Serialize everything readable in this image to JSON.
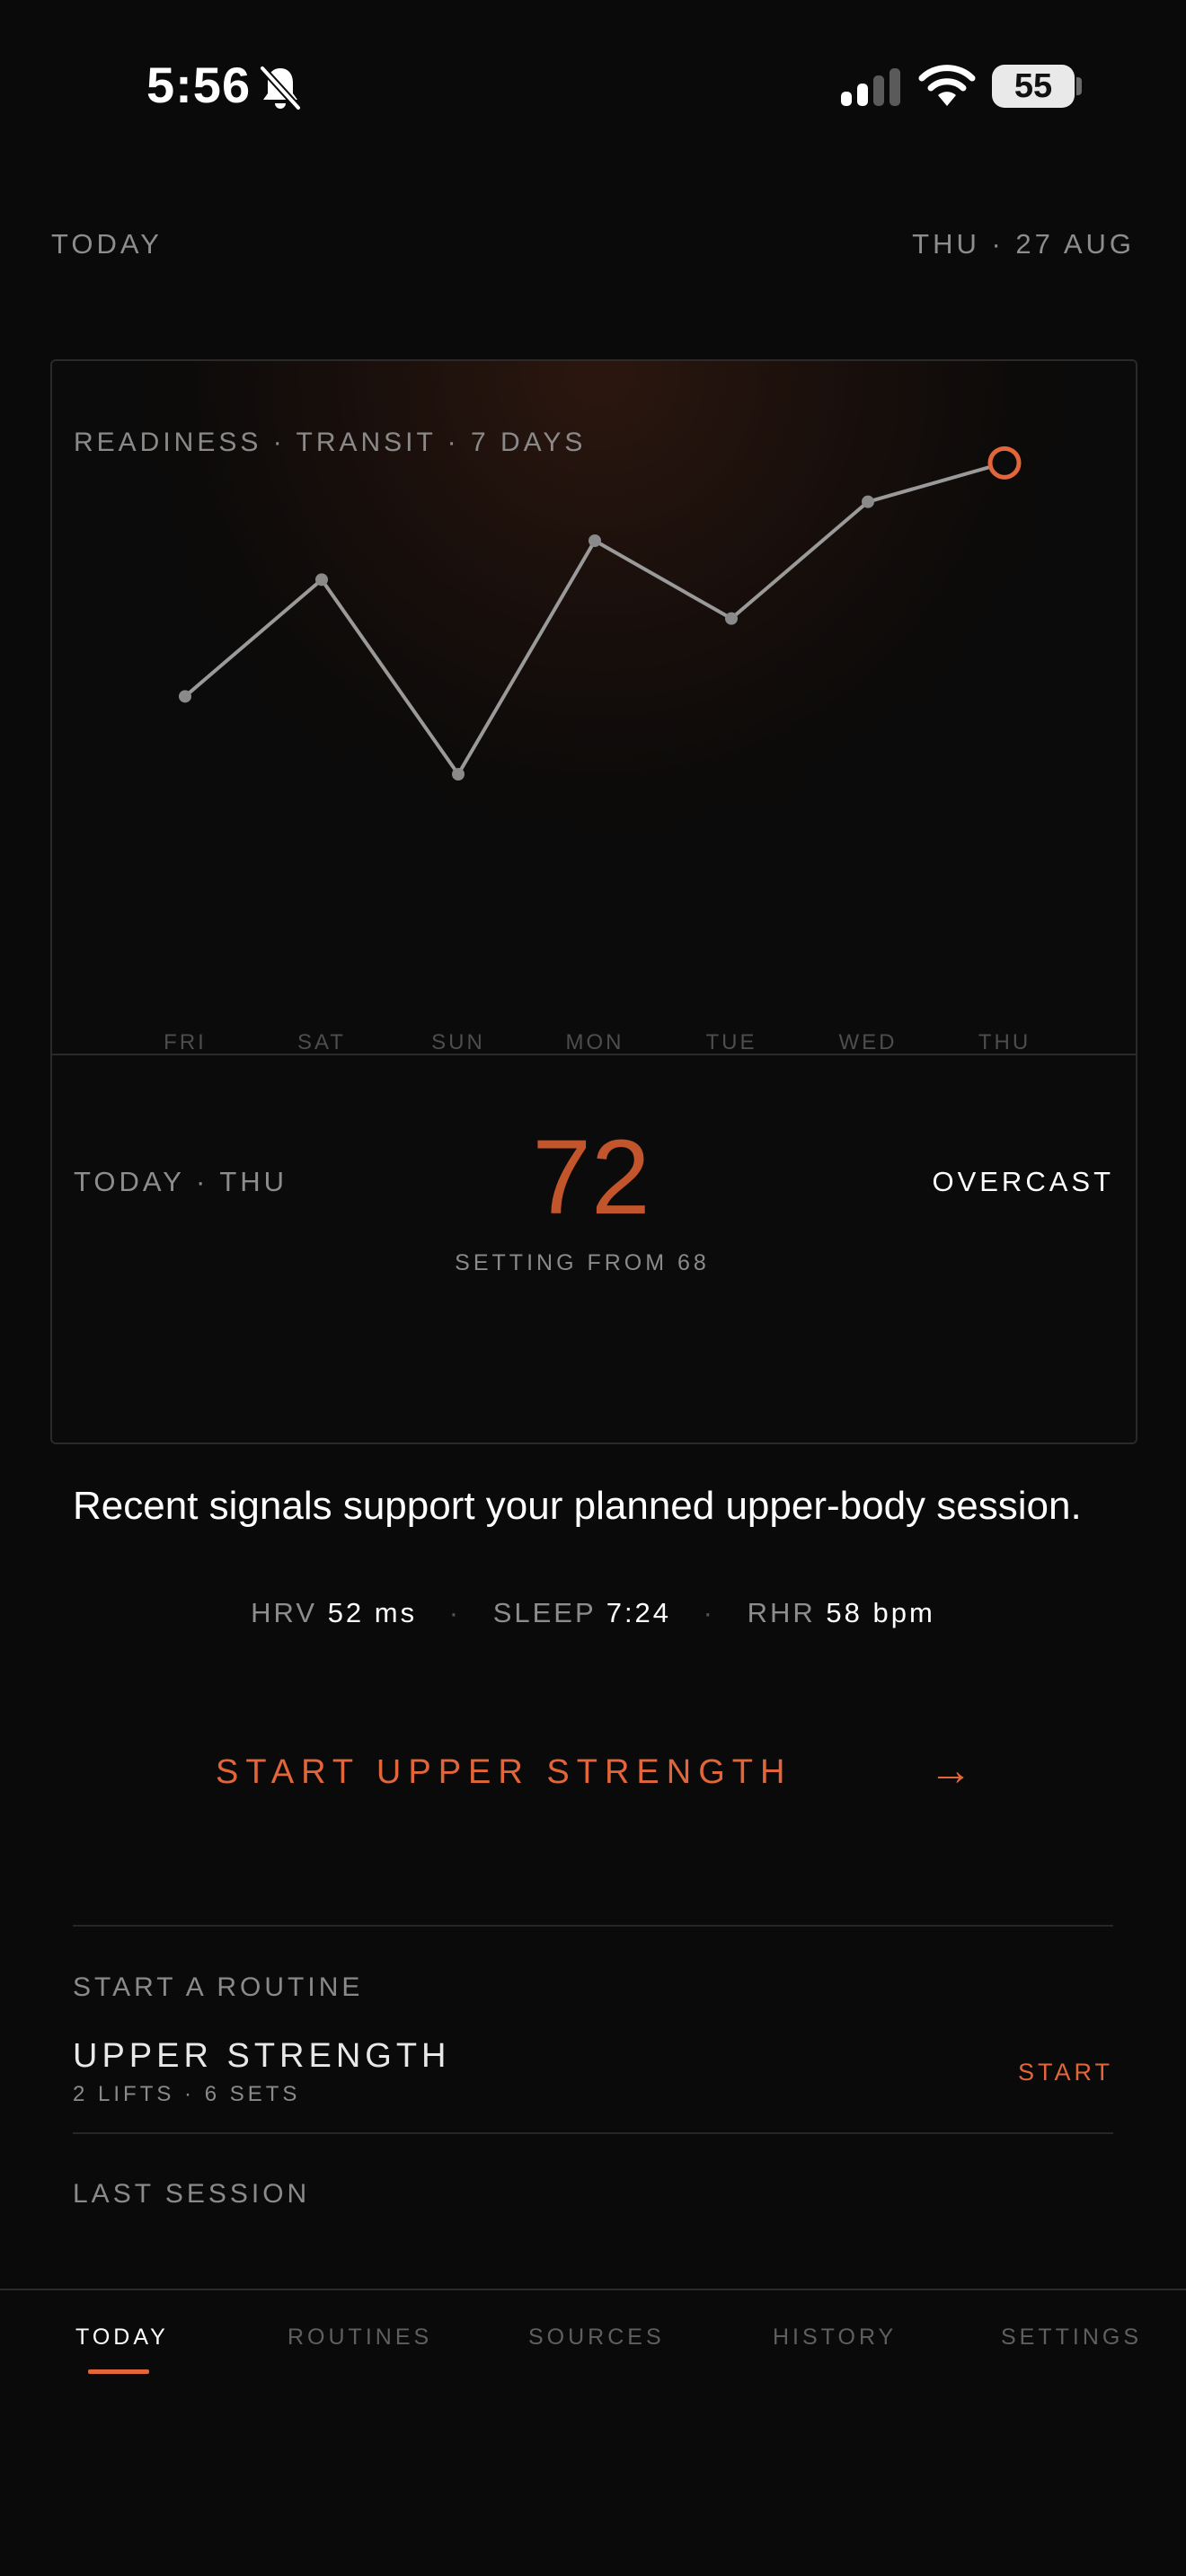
{
  "status_bar": {
    "time": "5:56",
    "battery": "55"
  },
  "header": {
    "left": "TODAY",
    "right": "THU · 27 AUG"
  },
  "card": {
    "label": "READINESS · TRANSIT · 7 DAYS",
    "today_label": "TODAY · THU",
    "score": "72",
    "score_sub": "SETTING FROM 68",
    "condition": "OVERCAST"
  },
  "chart_data": {
    "type": "line",
    "categories": [
      "FRI",
      "SAT",
      "SUN",
      "MON",
      "TUE",
      "WED",
      "THU"
    ],
    "values": [
      65,
      71,
      61,
      73,
      69,
      75,
      77
    ],
    "highlight_index": 6,
    "ylim": [
      55,
      85
    ],
    "grid": false,
    "line_color": "#9a9a9a",
    "highlight_color": "#e2663a"
  },
  "message": "Recent signals support your planned upper-body session.",
  "metrics": [
    {
      "label": "HRV",
      "value": "52 ms"
    },
    {
      "label": "SLEEP",
      "value": "7:24"
    },
    {
      "label": "RHR",
      "value": "58 bpm"
    }
  ],
  "cta": {
    "label": "START UPPER STRENGTH",
    "arrow": "→"
  },
  "routines": {
    "title": "START A ROUTINE",
    "items": [
      {
        "name": "UPPER STRENGTH",
        "detail": "2 LIFTS · 6 SETS",
        "action": "START"
      }
    ]
  },
  "last_session": {
    "title": "LAST SESSION"
  },
  "tabs": [
    {
      "label": "TODAY",
      "active": true
    },
    {
      "label": "ROUTINES",
      "active": false
    },
    {
      "label": "SOURCES",
      "active": false
    },
    {
      "label": "HISTORY",
      "active": false
    },
    {
      "label": "SETTINGS",
      "active": false
    }
  ],
  "colors": {
    "accent": "#e2663a",
    "score": "#c2552b",
    "background": "#0a0a0a"
  },
  "icons": [
    "bell-slash-icon",
    "signal-icon",
    "wifi-icon",
    "battery-icon",
    "arrow-right-icon"
  ]
}
